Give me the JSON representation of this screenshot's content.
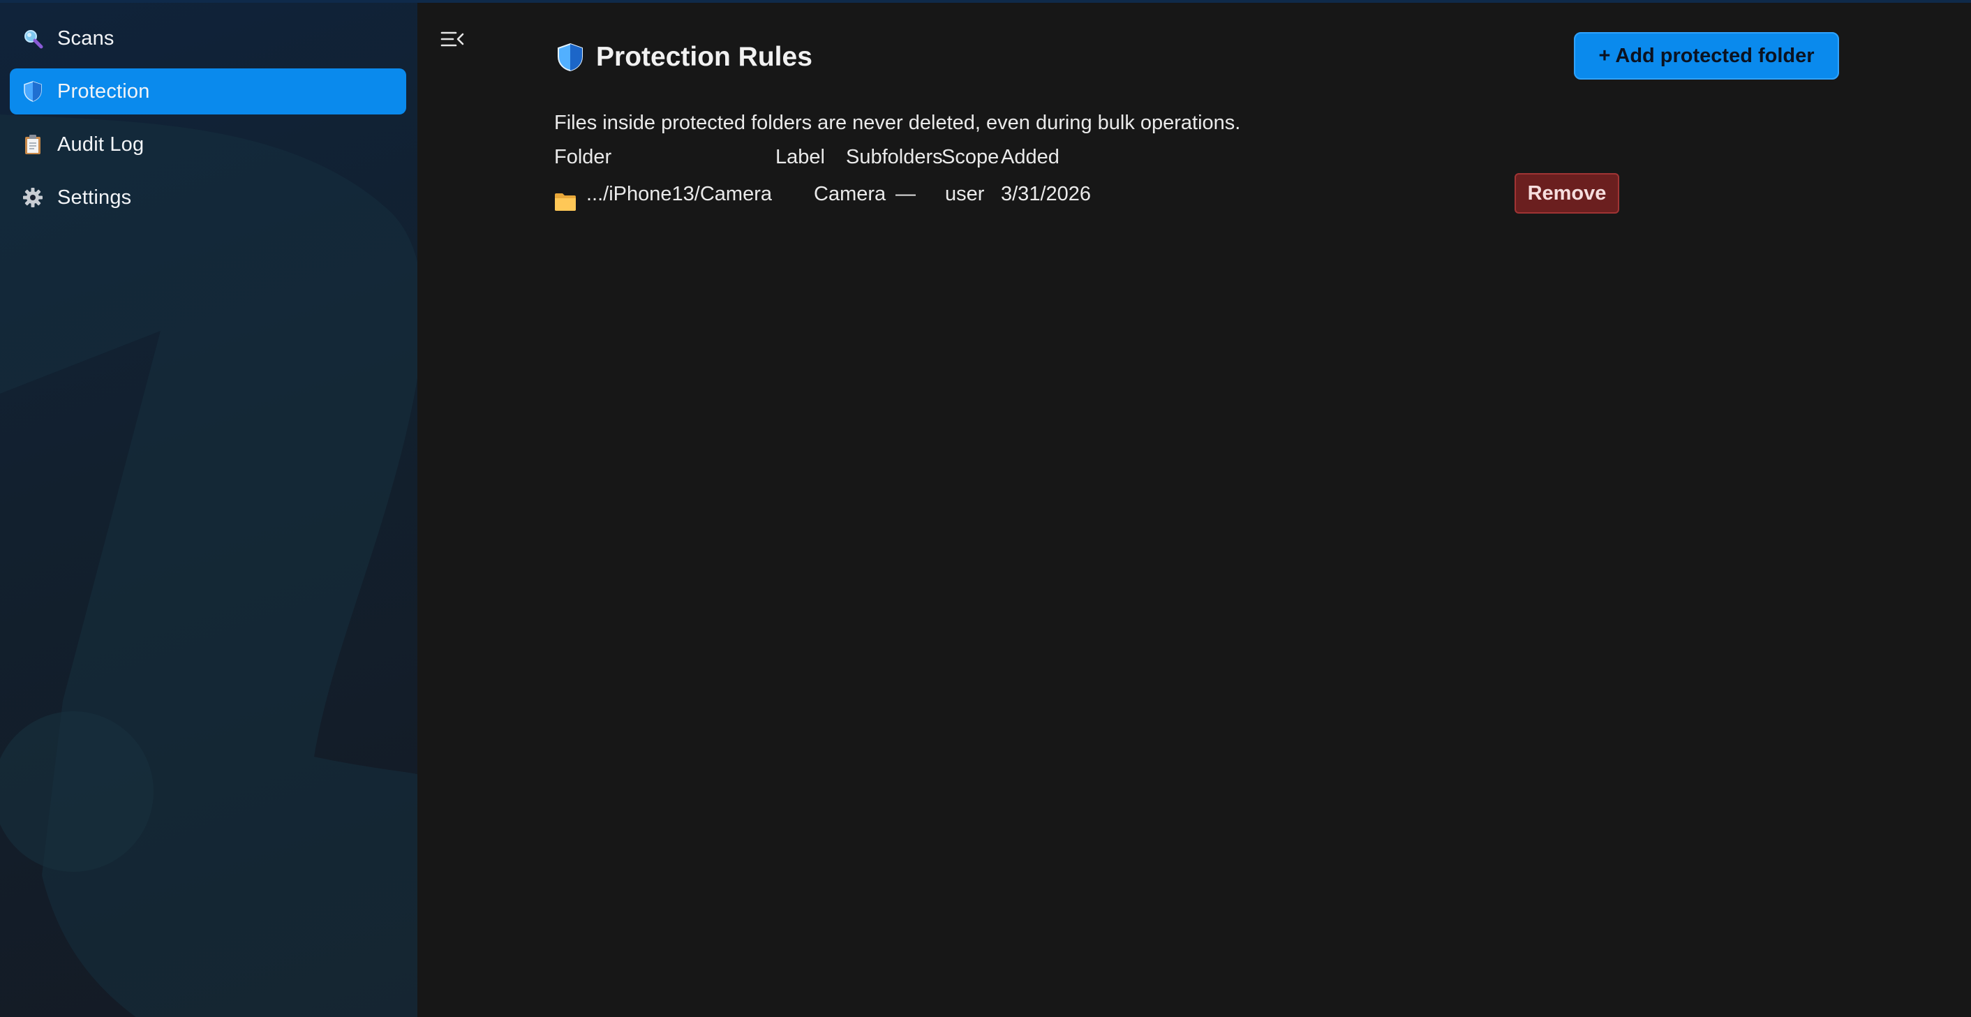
{
  "sidebar": {
    "items": [
      {
        "label": "Scans",
        "icon": "search-icon",
        "active": false
      },
      {
        "label": "Protection",
        "icon": "shield-icon",
        "active": true
      },
      {
        "label": "Audit Log",
        "icon": "clipboard-icon",
        "active": false
      },
      {
        "label": "Settings",
        "icon": "gear-icon",
        "active": false
      }
    ]
  },
  "main": {
    "title": "Protection Rules",
    "title_icon": "shield-icon",
    "add_button_label": "+ Add protected folder",
    "description": "Files inside protected folders are never deleted, even during bulk operations.",
    "table": {
      "headers": [
        "Folder",
        "Label",
        "Subfolders",
        "Scope",
        "Added"
      ],
      "rows": [
        {
          "folder": ".../iPhone13/Camera",
          "label": "Camera",
          "subfolders": "—",
          "scope": "user",
          "added": "3/31/2026",
          "action_label": "Remove"
        }
      ]
    }
  },
  "colors": {
    "accent": "#0a8aed",
    "danger": "#6b1f1f",
    "main_bg": "#171717",
    "sidebar_bg": "#12202e"
  }
}
